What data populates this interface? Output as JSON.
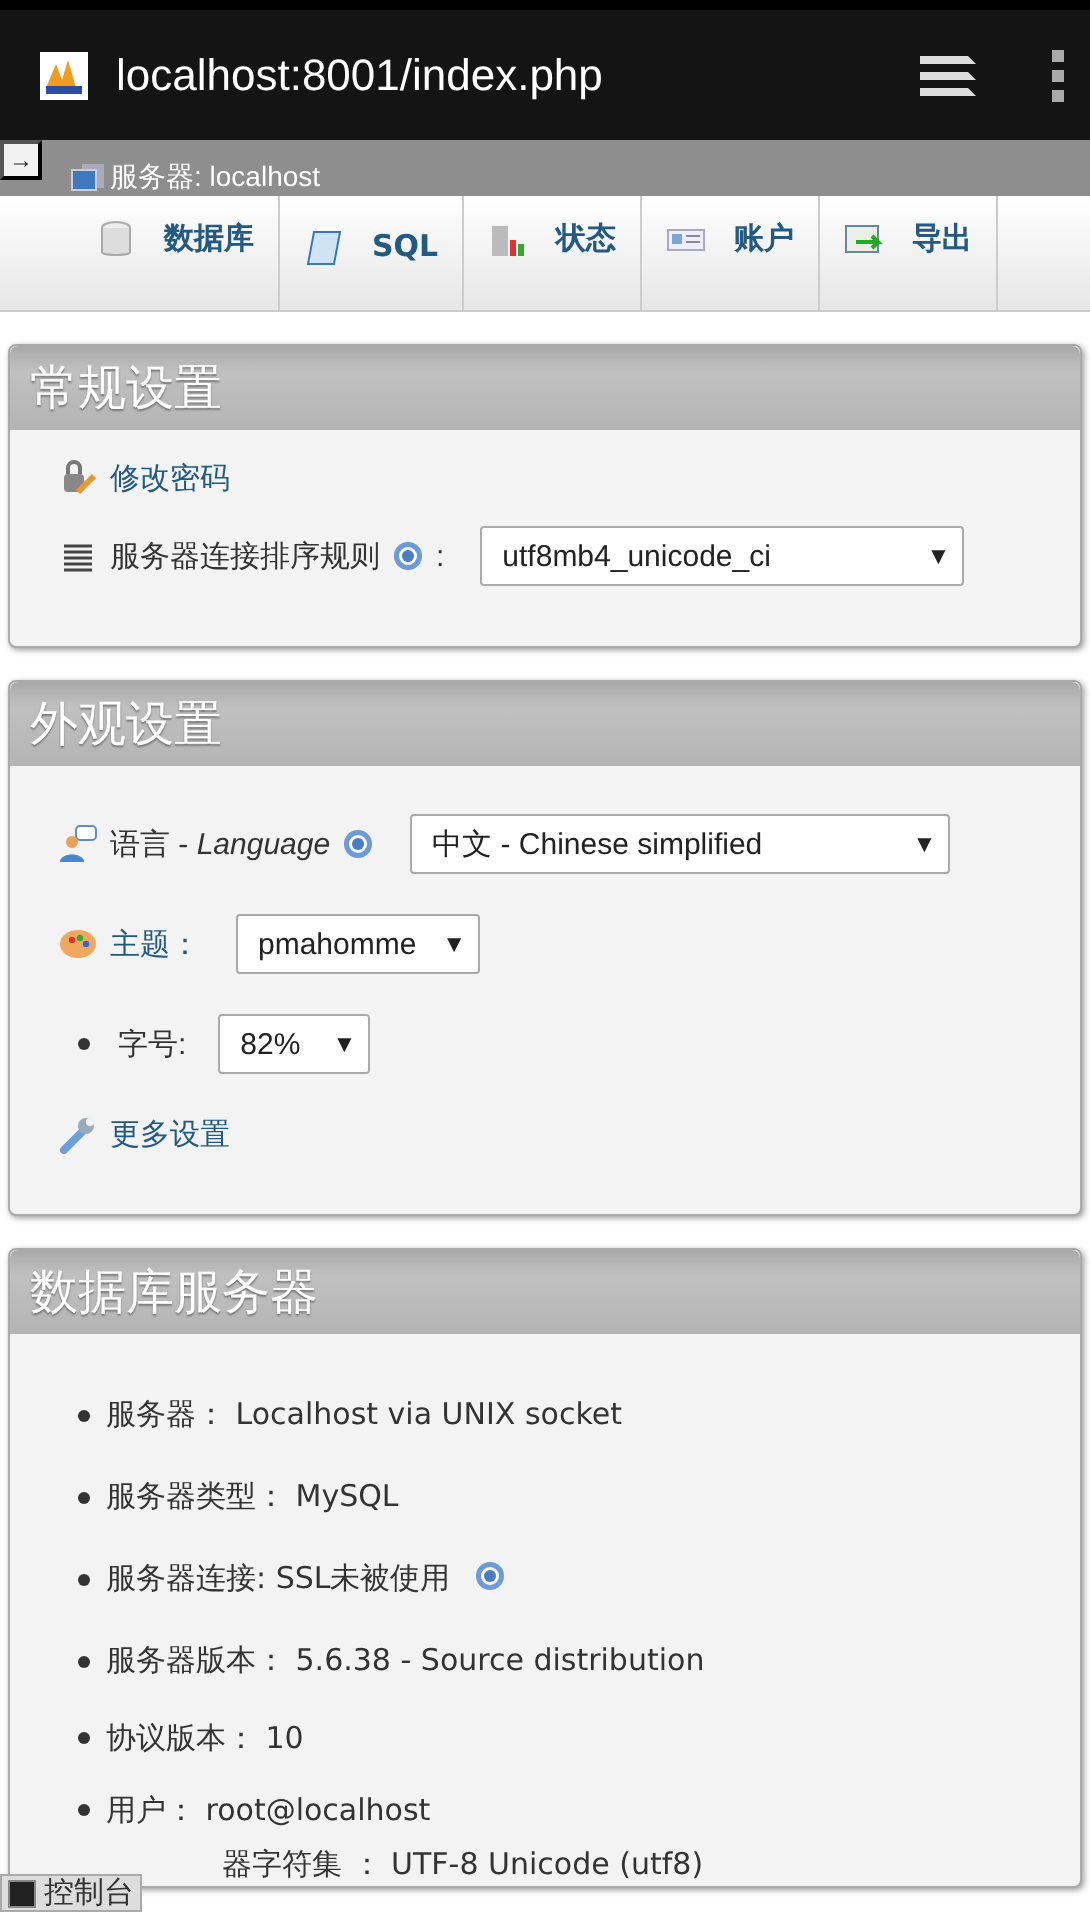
{
  "browser": {
    "url": "localhost:8001/index.php"
  },
  "breadcrumb": {
    "arrow": "→",
    "label": "服务器: localhost"
  },
  "tabs": [
    {
      "label": "数据库"
    },
    {
      "label": "SQL"
    },
    {
      "label": "状态"
    },
    {
      "label": "账户"
    },
    {
      "label": "导出"
    }
  ],
  "sections": [
    {
      "title": "常规设置",
      "items": [
        {
          "kind": "link",
          "label": "修改密码"
        },
        {
          "kind": "select",
          "label": "服务器连接排序规则",
          "help": true,
          "link": false,
          "colon": ":",
          "value": "utf8mb4_unicode_ci",
          "caret": "▼"
        }
      ]
    },
    {
      "title": "外观设置",
      "items": [
        {
          "kind": "select",
          "label": "语言 - *Language*",
          "help": true,
          "link": false,
          "value": "中文 - Chinese simplified",
          "caret": "▼"
        },
        {
          "kind": "select",
          "label": "主题：",
          "help": false,
          "link": true,
          "value": "pmahomme",
          "caret": "▼"
        },
        {
          "kind": "bullet-select",
          "label": "字号:",
          "value": "82%",
          "caret": "▼"
        },
        {
          "kind": "link",
          "label": "更多设置"
        }
      ]
    },
    {
      "title": "数据库服务器",
      "items": [
        {
          "kind": "bullet",
          "label": "服务器： Localhost via UNIX socket",
          "help": false
        },
        {
          "kind": "bullet",
          "label": "服务器类型： MySQL",
          "help": false
        },
        {
          "kind": "bullet",
          "label": "服务器连接: SSL未被使用",
          "help": true
        },
        {
          "kind": "bullet",
          "label": "服务器版本： 5.6.38 - Source distribution",
          "help": false
        },
        {
          "kind": "bullet",
          "label": "协议版本： 10",
          "help": false
        },
        {
          "kind": "bullet",
          "label": "用户： root@localhost",
          "help": false
        },
        {
          "kind": "cut",
          "label": "器字符集 ： UTF-8 Unicode (utf8)"
        }
      ]
    }
  ],
  "console": {
    "label": "控制台"
  }
}
